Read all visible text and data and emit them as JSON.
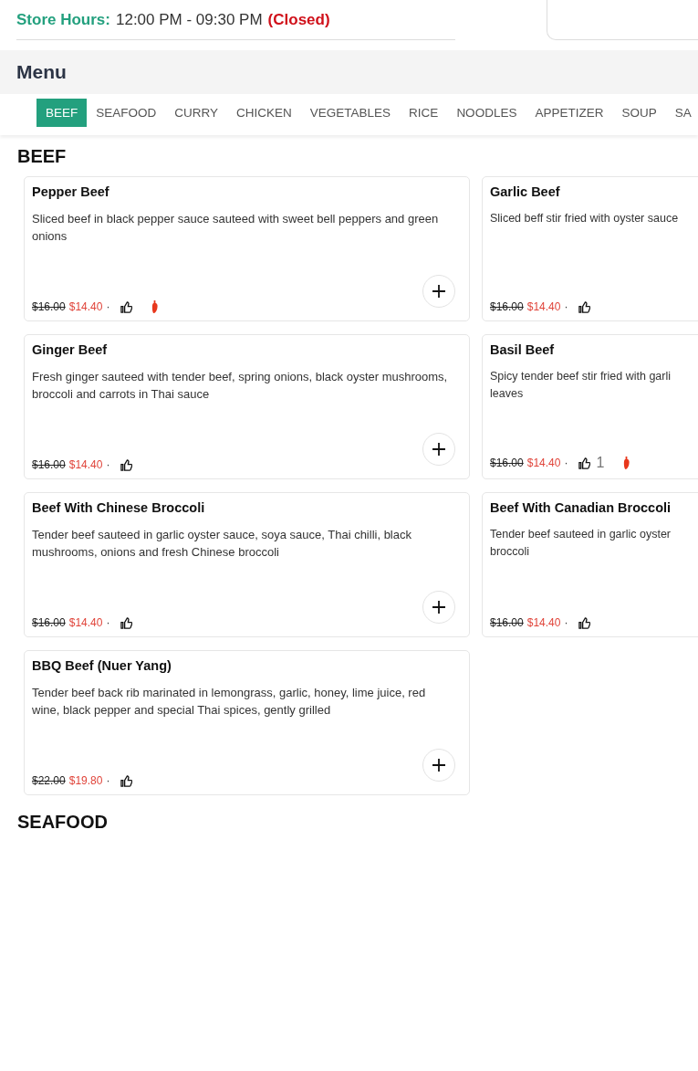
{
  "store_hours": {
    "label": "Store Hours:",
    "hours": "12:00 PM - 09:30 PM",
    "status": "(Closed)"
  },
  "menu": {
    "title": "Menu"
  },
  "tabs": [
    {
      "label": "BEEF",
      "selected": true
    },
    {
      "label": "SEAFOOD",
      "selected": false
    },
    {
      "label": "CURRY",
      "selected": false
    },
    {
      "label": "CHICKEN",
      "selected": false
    },
    {
      "label": "VEGETABLES",
      "selected": false
    },
    {
      "label": "RICE",
      "selected": false
    },
    {
      "label": "NOODLES",
      "selected": false
    },
    {
      "label": "APPETIZER",
      "selected": false
    },
    {
      "label": "SOUP",
      "selected": false
    },
    {
      "label": "SA",
      "selected": false
    }
  ],
  "sections": [
    {
      "title": "BEEF",
      "items": [
        {
          "name": "Pepper Beef",
          "description": "Sliced beef in black pepper sauce sauteed with sweet bell peppers and green onions",
          "old_price": "$16.00",
          "price": "$14.40",
          "separator": "·",
          "spicy": true,
          "add_button": true
        },
        {
          "name": "Garlic Beef",
          "description": "Sliced beff stir fried with oyster sauce",
          "old_price": "$16.00",
          "price": "$14.40",
          "separator": "·",
          "spicy": false,
          "add_button": false
        },
        {
          "name": "Ginger Beef",
          "description": "Fresh ginger sauteed with tender beef, spring onions, black oyster mushrooms, broccoli and carrots in Thai sauce",
          "old_price": "$16.00",
          "price": "$14.40",
          "separator": "·",
          "spicy": false,
          "add_button": true
        },
        {
          "name": "Basil Beef",
          "description": "Spicy tender beef stir fried with garli leaves",
          "old_price": "$16.00",
          "price": "$14.40",
          "separator": "·",
          "likes": "1",
          "spicy": true,
          "add_button": false
        },
        {
          "name": "Beef With Chinese Broccoli",
          "description": "Tender beef sauteed in garlic oyster sauce, soya sauce, Thai chilli, black mushrooms, onions and fresh Chinese broccoli",
          "old_price": "$16.00",
          "price": "$14.40",
          "separator": "·",
          "spicy": false,
          "add_button": true
        },
        {
          "name": "Beef With Canadian Broccoli",
          "description": "Tender beef sauteed in garlic oyster broccoli",
          "old_price": "$16.00",
          "price": "$14.40",
          "separator": "·",
          "spicy": false,
          "add_button": false
        },
        {
          "name": "BBQ Beef (Nuer Yang)",
          "description": "Tender beef back rib marinated in lemongrass, garlic, honey, lime juice, red wine, black pepper and special Thai spices, gently grilled",
          "old_price": "$22.00",
          "price": "$19.80",
          "separator": "·",
          "spicy": false,
          "add_button": true
        }
      ]
    },
    {
      "title": "SEAFOOD"
    }
  ]
}
